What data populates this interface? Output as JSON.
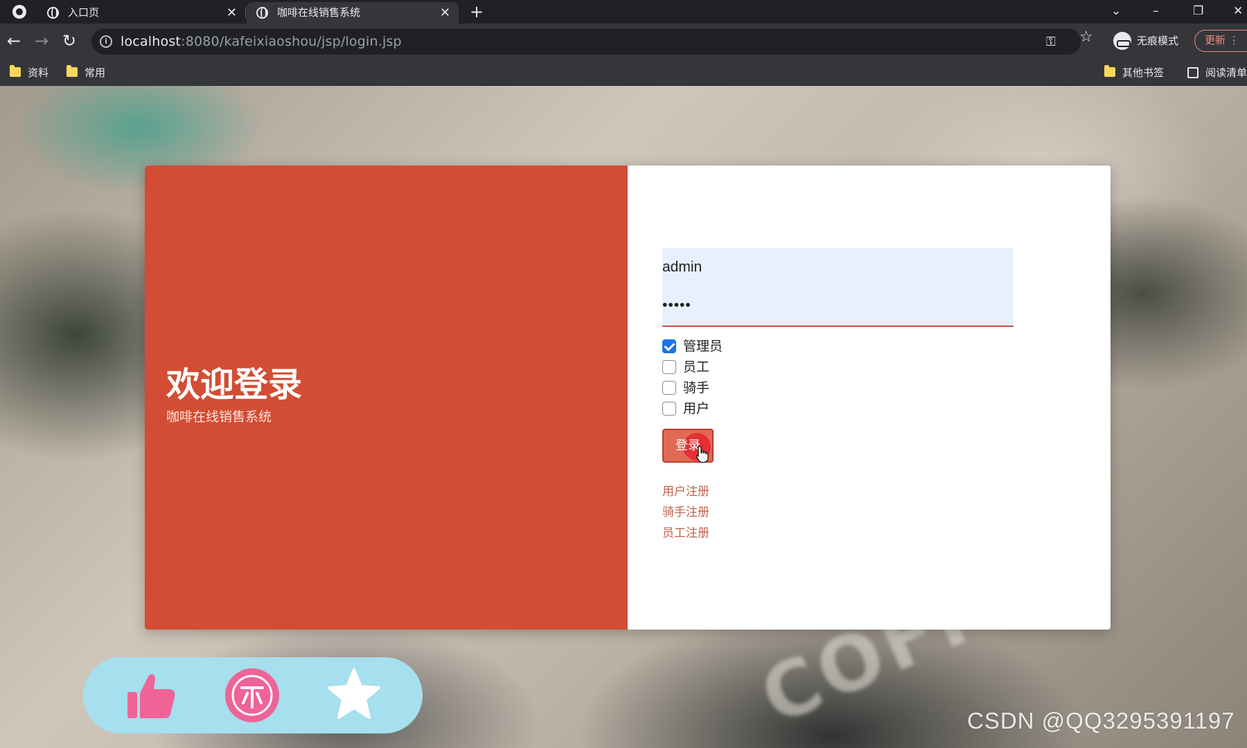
{
  "browser": {
    "tabs": [
      {
        "title": "入口页",
        "active": false
      },
      {
        "title": "咖啡在线销售系统",
        "active": true
      }
    ],
    "url_host": "localhost",
    "url_rest": ":8080/kafeixiaoshou/jsp/login.jsp",
    "incognito_label": "无痕模式",
    "update_label": "更新",
    "bookmarks": [
      {
        "label": "资料"
      },
      {
        "label": "常用"
      }
    ],
    "other_bookmarks_label": "其他书签",
    "reading_list_label": "阅读清单"
  },
  "login": {
    "welcome_title": "欢迎登录",
    "system_name": "咖啡在线销售系统",
    "username_value": "admin",
    "password_value": "•••••",
    "roles": [
      {
        "label": "管理员",
        "checked": true
      },
      {
        "label": "员工",
        "checked": false
      },
      {
        "label": "骑手",
        "checked": false
      },
      {
        "label": "用户",
        "checked": false
      }
    ],
    "login_button_label": "登录",
    "register_links": [
      {
        "label": "用户注册"
      },
      {
        "label": "骑手注册"
      },
      {
        "label": "员工注册"
      }
    ]
  },
  "action_bar": {
    "icons": [
      "thumbs-up-icon",
      "coin-icon",
      "star-icon"
    ]
  },
  "background": {
    "text": "COFFEE"
  },
  "watermark": "CSDN @QQ3295391197",
  "colors": {
    "brand_red": "#d24d33",
    "input_bg": "#e8f0fe",
    "checkbox_blue": "#1a73e8",
    "link_color": "#c0624b",
    "action_bar_bg": "#a6dfee",
    "icon_pink": "#ef6497"
  }
}
